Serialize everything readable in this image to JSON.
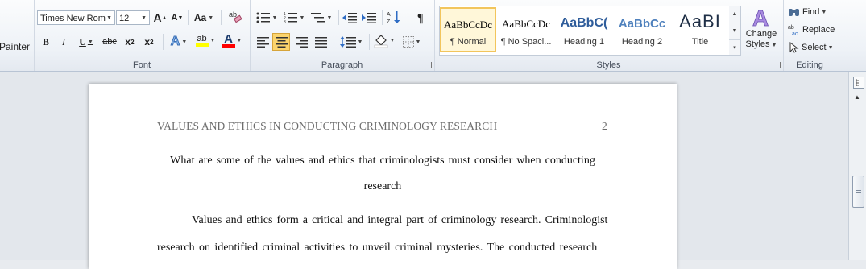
{
  "clipboard": {
    "painter_label": "Painter"
  },
  "font": {
    "group_label": "Font",
    "font_name": "Times New Rom",
    "font_size": "12",
    "grow_label": "A",
    "shrink_label": "A",
    "case_label": "Aa",
    "bold": "B",
    "italic": "I",
    "underline": "U",
    "strikethrough": "abc",
    "subscript": "x",
    "superscript": "x",
    "effects_label": "A",
    "highlight_label": "ab",
    "font_color_label": "A",
    "highlight_color": "#ffff00",
    "font_color": "#ff0000"
  },
  "paragraph": {
    "group_label": "Paragraph",
    "pilcrow": "¶"
  },
  "styles": {
    "group_label": "Styles",
    "tiles": [
      {
        "sample": "AaBbCcDc",
        "name": "¶ Normal",
        "color": "#000000"
      },
      {
        "sample": "AaBbCcDc",
        "name": "¶ No Spaci...",
        "color": "#000000"
      },
      {
        "sample": "AaBbC(",
        "name": "Heading 1",
        "color": "#2f5d9b"
      },
      {
        "sample": "AaBbCc",
        "name": "Heading 2",
        "color": "#4f81bd"
      },
      {
        "sample": "AaBI",
        "name": "Title",
        "color": "#1f2f46"
      }
    ],
    "change_styles_line1": "Change",
    "change_styles_line2": "Styles"
  },
  "editing": {
    "group_label": "Editing",
    "find": "Find",
    "replace": "Replace",
    "select": "Select"
  },
  "document": {
    "header_title": "VALUES AND ETHICS IN CONDUCTING CRIMINOLOGY RESEARCH",
    "header_page": "2",
    "question_line1": "What are some of the values and ethics that criminologists must consider when conducting",
    "question_line2": "research",
    "para_line1": "Values and ethics form a critical and integral part of criminology research. Criminologist",
    "para_line2": "research on identified criminal activities to unveil criminal mysteries. The conducted research"
  }
}
